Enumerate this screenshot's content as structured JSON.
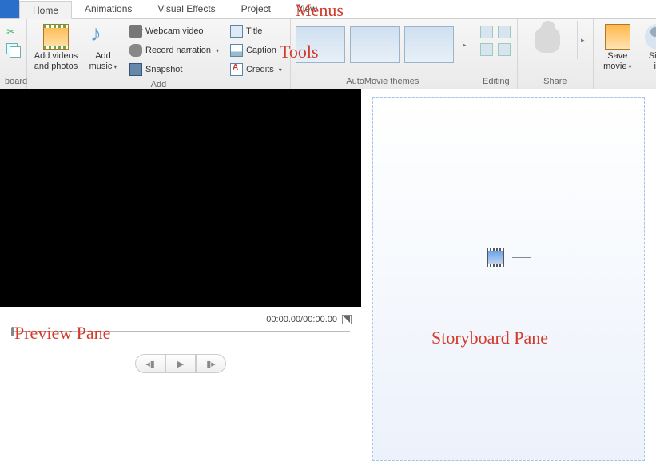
{
  "tabs": {
    "home": "Home",
    "animations": "Animations",
    "visual_effects": "Visual Effects",
    "project": "Project",
    "view": "View"
  },
  "groups": {
    "clipboard": "board",
    "add": "Add",
    "automovie": "AutoMovie themes",
    "editing": "Editing",
    "share": "Share"
  },
  "buttons": {
    "add_videos": "Add videos\nand photos",
    "add_music": "Add\nmusic",
    "webcam": "Webcam video",
    "record": "Record narration",
    "snapshot": "Snapshot",
    "title": "Title",
    "caption": "Caption",
    "credits": "Credits",
    "save_movie": "Save\nmovie",
    "sign_in": "Sign\nin"
  },
  "preview": {
    "time": "00:00.00/00:00.00"
  },
  "annotations": {
    "menus": "Menus",
    "tools": "Tools",
    "preview": "Preview Pane",
    "storyboard": "Storyboard Pane"
  }
}
